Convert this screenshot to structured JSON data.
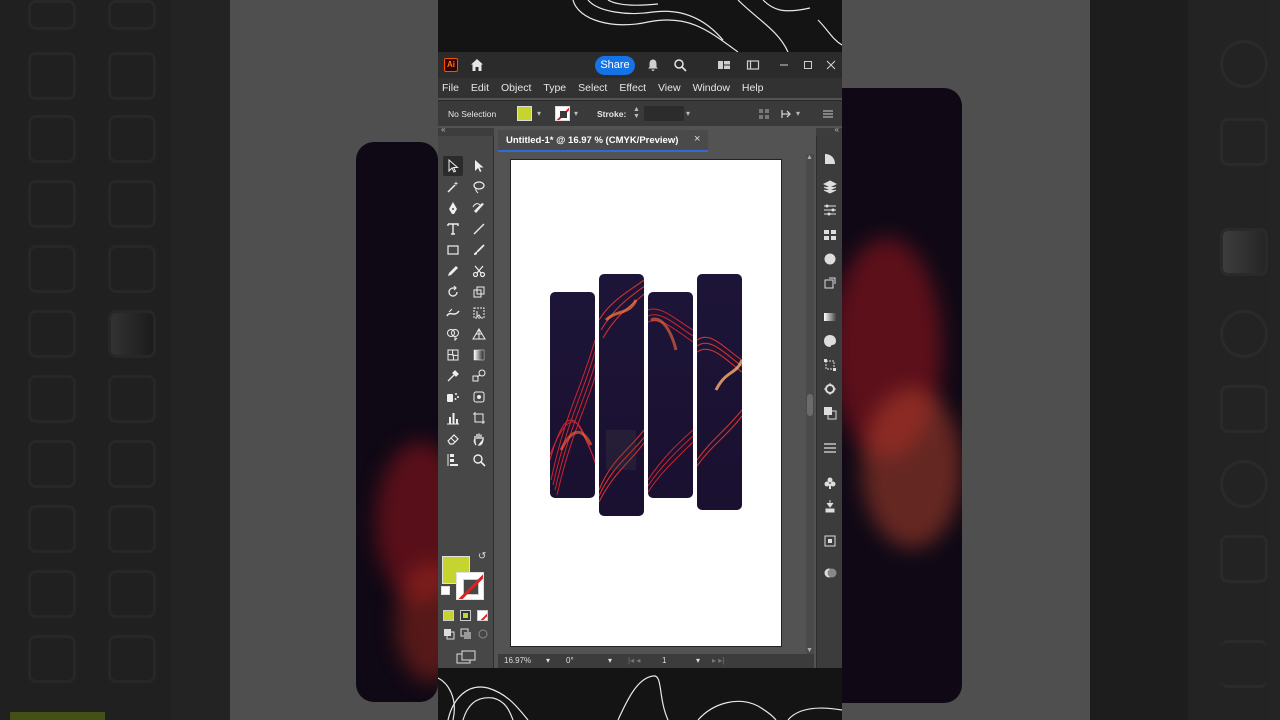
{
  "app": {
    "logo": "Ai",
    "share_label": "Share",
    "menu": [
      "File",
      "Edit",
      "Object",
      "Type",
      "Select",
      "Effect",
      "View",
      "Window",
      "Help"
    ],
    "control_bar": {
      "selection": "No Selection",
      "fill_color": "#c5d42e",
      "stroke_label": "Stroke:"
    },
    "document_tab": {
      "title": "Untitled-1* @ 16.97 % (CMYK/Preview)",
      "close": "×"
    },
    "status": {
      "zoom": "16.97%",
      "rotation": "0°",
      "artboard_number": "1"
    }
  },
  "toolbar": {
    "tools": [
      "selection-tool",
      "direct-selection-tool",
      "magic-wand-tool",
      "lasso-tool",
      "pen-tool",
      "curvature-tool",
      "type-tool",
      "line-tool",
      "rectangle-tool",
      "paintbrush-tool",
      "pencil-tool",
      "scissors-tool",
      "rotate-tool",
      "scale-tool",
      "warp-tool",
      "free-transform-tool",
      "shape-builder-tool",
      "perspective-grid-tool",
      "mesh-tool",
      "gradient-tool",
      "eyedropper-tool",
      "blend-tool",
      "symbol-sprayer-tool",
      "column-graph-tool",
      "artboard-tool",
      "slice-tool",
      "eraser-tool",
      "hand-tool",
      "print-tiling-tool",
      "zoom-tool"
    ],
    "more_label": "•••"
  },
  "colors": {
    "accent": "#1473e6",
    "fill": "#c5d42e",
    "stroke_none": "#e02020"
  }
}
